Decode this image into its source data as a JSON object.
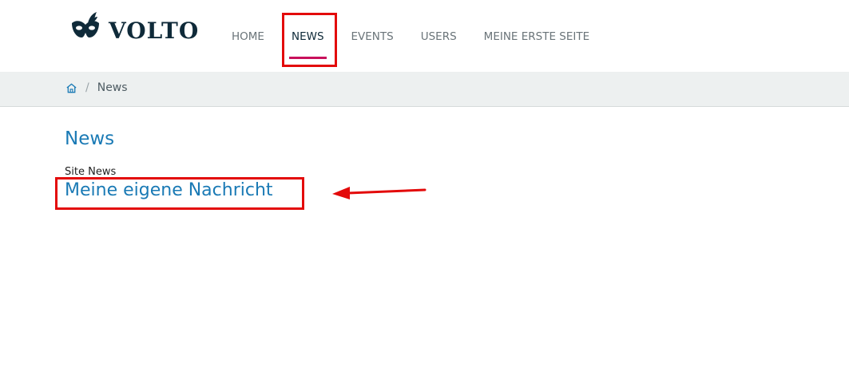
{
  "header": {
    "logo_text": "VOLTO",
    "logo_icon": "mask-icon",
    "nav": [
      {
        "label": "HOME"
      },
      {
        "label": "NEWS",
        "active": true
      },
      {
        "label": "EVENTS"
      },
      {
        "label": "USERS"
      },
      {
        "label": "MEINE ERSTE SEITE"
      }
    ],
    "active_underline_color": "#c8115b"
  },
  "breadcrumb": {
    "home_icon": "home-icon",
    "separator": "/",
    "current": "News"
  },
  "main": {
    "title": "News",
    "section_label": "Site News",
    "items": [
      {
        "title": "Meine eigene Nachricht"
      }
    ]
  },
  "annotations": {
    "highlight_color": "#e30a0a",
    "arrow_icon": "arrow-left-icon"
  }
}
